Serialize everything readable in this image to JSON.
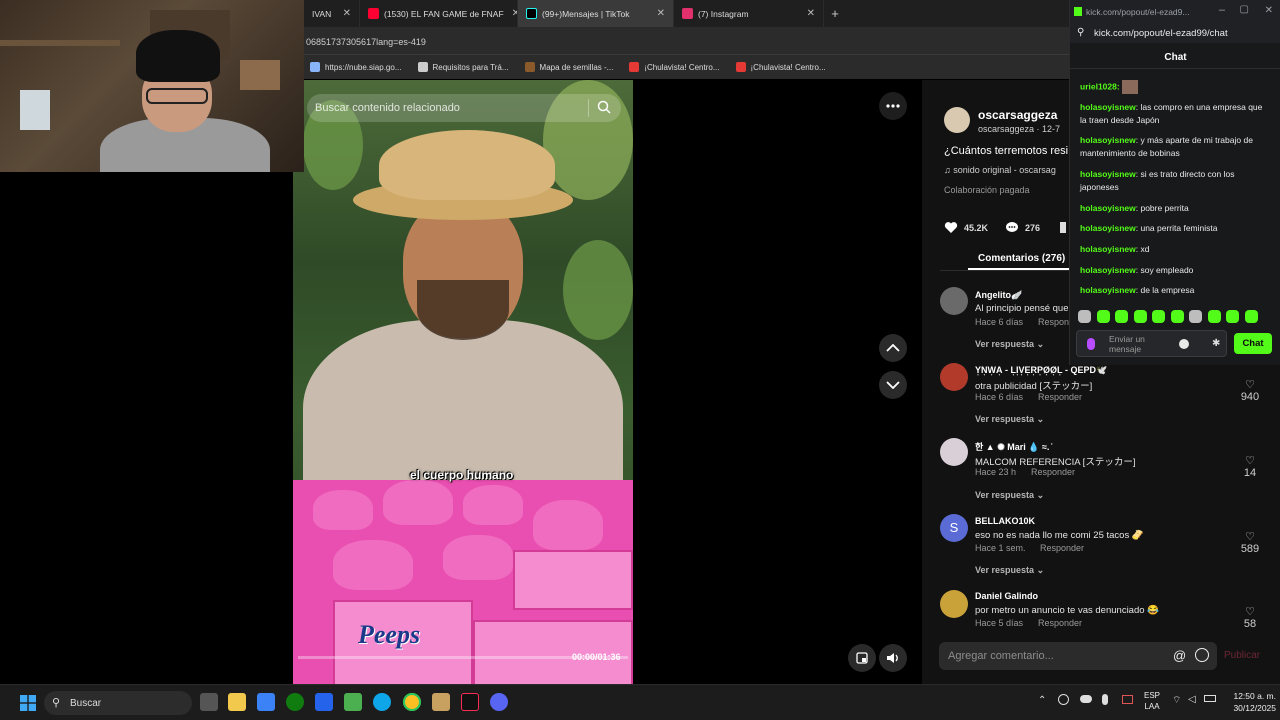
{
  "browser": {
    "tabs": [
      {
        "label": "IVAN",
        "color": "#555555",
        "active": false
      },
      {
        "label": "(1530) EL FAN GAME de FNAF",
        "color": "#ff0033",
        "active": false
      },
      {
        "label": "(99+)Mensajes | TikTok",
        "color": "#25f4ee",
        "active": true
      },
      {
        "label": "(7) Instagram",
        "color": "#e1306c",
        "active": false
      }
    ],
    "new_tab": "+",
    "address": "06851737305617lang=es-419",
    "bookmarks": [
      {
        "label": "https://nube.siap.go...",
        "color": "#8ab4f8"
      },
      {
        "label": "Requisitos para Trá...",
        "color": "#cccccc"
      },
      {
        "label": "Mapa de semillas -...",
        "color": "#8b5a2b"
      },
      {
        "label": "¡Chulavista! Centro...",
        "color": "#e53935"
      },
      {
        "label": "¡Chulavista! Centro...",
        "color": "#e53935"
      }
    ]
  },
  "video": {
    "search_placeholder": "Buscar contenido relacionado",
    "caption": "el cuerpo humano",
    "time": "00:00/01:36",
    "progress": 0.0,
    "box_brand": "Peeps"
  },
  "post": {
    "username": "oscarsaggeza",
    "handle_date": "oscarsaggeza · 12-7",
    "description": "¿Cuántos terremotos resis",
    "sound": "sonido original - oscarsag",
    "paid_tag": "Colaboración pagada",
    "likes": "45.2K",
    "comments_count": "276",
    "comments_tab": "Comentarios (276)"
  },
  "comments": [
    {
      "name": "Angelito🪽",
      "text": "Al principio pensé que",
      "time": "Hace 6 días",
      "reply": "Respond",
      "replies": "Ver respuesta",
      "likes": "",
      "avatar": "#6a6a6a"
    },
    {
      "name": "Y͎N͎W͎A͎ - L͎I͎V͎E͎R͎P͎Ø͎Ø͎L͎ - QEPD🕊️",
      "text": "otra publicidad [ステッカー]",
      "time": "Hace 6 días",
      "reply": "Responder",
      "replies": "Ver respuesta",
      "likes": "940",
      "avatar": "#b23a2b"
    },
    {
      "name": "한 ▲ ✺ Mari 💧 ≈. ͐",
      "text": "MALCOM REFERENCIA [ステッカー]",
      "time": "Hace 23 h",
      "reply": "Responder",
      "replies": "Ver respuesta",
      "likes": "14",
      "avatar": "#d8d0d6"
    },
    {
      "name": "BELLAKO10K",
      "text": "eso no es nada llo me comi 25 tacos 🫔",
      "time": "Hace 1 sem.",
      "reply": "Responder",
      "replies": "Ver respuesta",
      "likes": "589",
      "avatar": "#5b6bd6",
      "initial": "S"
    },
    {
      "name": "Daniel Galindo",
      "text": "por metro un anuncio te vas denunciado 😂",
      "time": "Hace 5 días",
      "reply": "Responder",
      "replies": "",
      "likes": "58",
      "avatar": "#c9a23a"
    }
  ],
  "comment_box": {
    "placeholder": "Agregar comentario...",
    "publish": "Publicar"
  },
  "kick": {
    "window_title": "kick.com/popout/el-ezad9...",
    "url": "kick.com/popout/el-ezad99/chat",
    "header": "Chat",
    "messages": [
      {
        "user": "uriel1028:",
        "text": ""
      },
      {
        "user": "holasoyisnew",
        "text": ": las compro en una empresa que la traen desde Japón"
      },
      {
        "user": "holasoyisnew",
        "text": ": y más aparte de mi trabajo de mantenimiento de bobinas"
      },
      {
        "user": "holasoyisnew",
        "text": ": si es trato directo con los japoneses"
      },
      {
        "user": "holasoyisnew",
        "text": ": pobre perrita"
      },
      {
        "user": "holasoyisnew",
        "text": ": una perrita feminista"
      },
      {
        "user": "holasoyisnew",
        "text": ": xd"
      },
      {
        "user": "holasoyisnew",
        "text": ": soy empleado"
      },
      {
        "user": "holasoyisnew",
        "text": ": de la empresa"
      }
    ],
    "input_placeholder": "Enviar un mensaje",
    "send_label": "Chat"
  },
  "taskbar": {
    "search": "Buscar",
    "lang_line1": "ESP",
    "lang_line2": "LAA",
    "time": "12:50 a. m.",
    "date": "30/12/2025"
  }
}
